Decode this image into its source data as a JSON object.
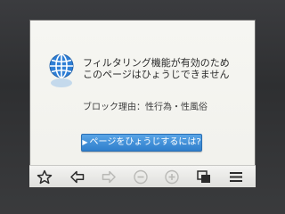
{
  "message": {
    "line1": "フィルタリング機能が有効のため",
    "line2": "このページはひょうじできません",
    "reason": "ブロック理由：性行為・性風俗"
  },
  "cta": {
    "arrow": "▶",
    "label": "ページをひょうじするには?"
  },
  "toolbar": {
    "icons": [
      "star-icon",
      "back-icon",
      "forward-icon",
      "minus-icon",
      "plus-icon",
      "tabs-icon",
      "menu-icon"
    ],
    "enabled": [
      true,
      true,
      false,
      false,
      false,
      true,
      true
    ]
  },
  "colors": {
    "accent": "#2f7fcc",
    "globe": "#2f7fd6",
    "screen_bg": "#f4f4f0",
    "bezel": "#2e2f31"
  }
}
